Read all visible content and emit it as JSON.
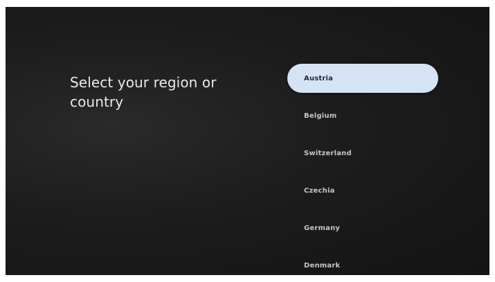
{
  "page": {
    "title": "Select your region or country"
  },
  "regions": {
    "selected_index": 0,
    "items": [
      {
        "label": "Austria"
      },
      {
        "label": "Belgium"
      },
      {
        "label": "Switzerland"
      },
      {
        "label": "Czechia"
      },
      {
        "label": "Germany"
      },
      {
        "label": "Denmark"
      }
    ]
  },
  "colors": {
    "background": "#1c1c1c",
    "focus_pill": "#d6e3f5",
    "text_primary": "#e8eaed",
    "text_secondary": "#c4c7c5"
  }
}
